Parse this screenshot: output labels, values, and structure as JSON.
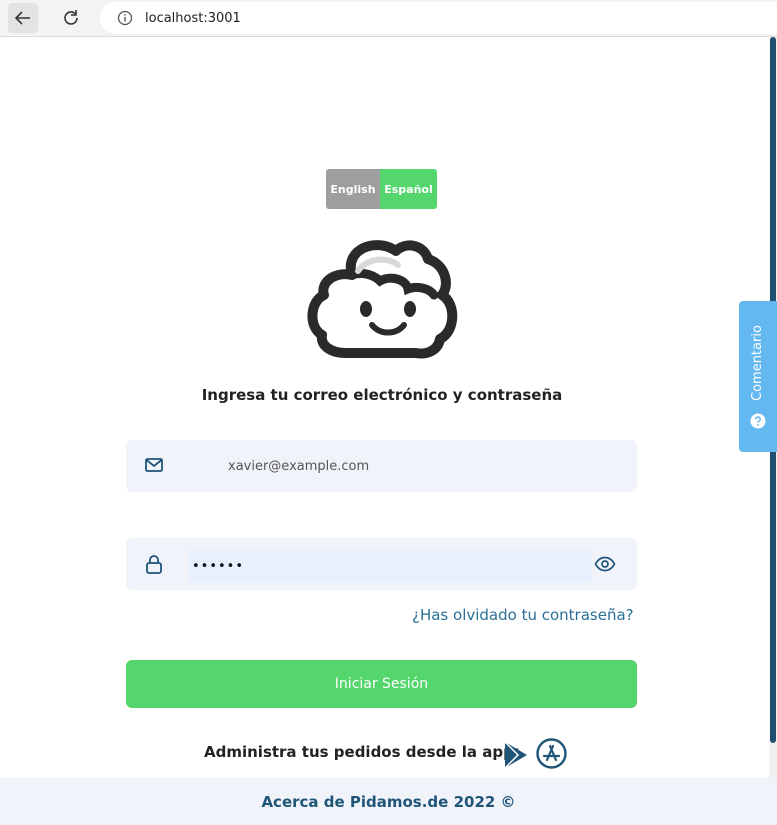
{
  "browser": {
    "url": "localhost:3001",
    "icons": [
      "back-arrow-icon",
      "reload-icon",
      "info-icon"
    ]
  },
  "language": {
    "english": "English",
    "spanish": "Español",
    "selected": "Español",
    "colors": {
      "inactive": "#9e9e9e",
      "active": "#54d66c"
    }
  },
  "login": {
    "subtitle": "Ingresa tu correo electrónico y contraseña",
    "email_value": "xavier@example.com",
    "password_value": "••••••",
    "forgot_link": "¿Has olvidado tu contraseña?",
    "submit_label": "Iniciar Sesión",
    "icons": [
      "mail-icon",
      "lock-icon",
      "eye-icon"
    ]
  },
  "app": {
    "text": "Administra tus pedidos desde la app:",
    "icons": [
      "google-play-icon",
      "app-store-icon"
    ]
  },
  "footer": {
    "text": "Acerca de Pidamos.de 2022 ©"
  },
  "feedback": {
    "label": "Comentario",
    "icon": "question-icon"
  },
  "colors": {
    "brand_green": "#54d66c",
    "link_blue": "#2a6f97",
    "field_bg": "#f1f3fb",
    "feedback_blue": "#63b8ef"
  }
}
